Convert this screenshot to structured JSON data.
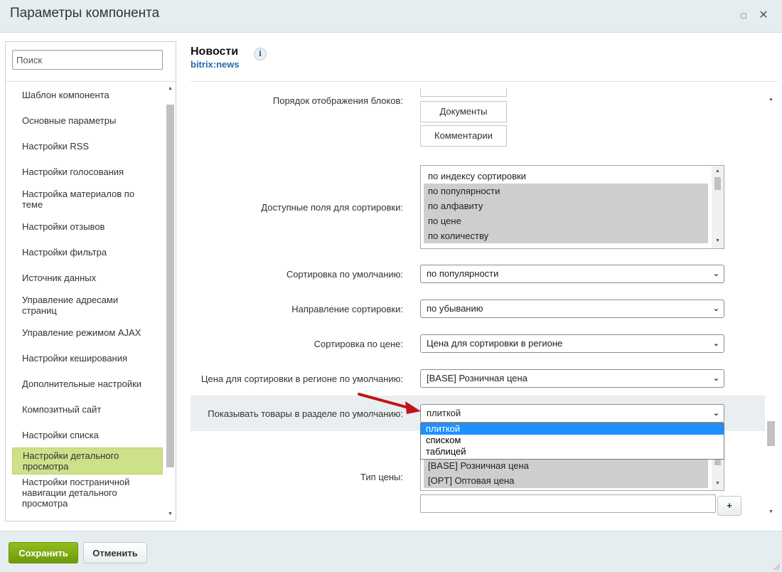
{
  "window": {
    "title": "Параметры компонента",
    "maximize_icon": "□",
    "close_icon": "✕"
  },
  "search": {
    "placeholder": "Поиск",
    "value": ""
  },
  "sidebar": {
    "items": [
      {
        "label": "Шаблон компонента"
      },
      {
        "label": "Основные параметры"
      },
      {
        "label": "Настройки RSS"
      },
      {
        "label": "Настройки голосования"
      },
      {
        "label": "Настройка материалов по теме"
      },
      {
        "label": "Настройки отзывов"
      },
      {
        "label": "Настройки фильтра"
      },
      {
        "label": "Источник данных"
      },
      {
        "label": "Управление адресами страниц"
      },
      {
        "label": "Управление режимом AJAX"
      },
      {
        "label": "Настройки кеширования"
      },
      {
        "label": "Дополнительные настройки"
      },
      {
        "label": "Композитный сайт"
      },
      {
        "label": "Настройки списка"
      },
      {
        "label": "Настройки детального просмотра",
        "active": true
      },
      {
        "label": "Настройки постраничной навигации детального просмотра"
      }
    ],
    "active_color": "#cce18a"
  },
  "component": {
    "title": "Новости",
    "info_icon": "i",
    "subtitle": "bitrix:news"
  },
  "form": {
    "block_order": {
      "label": "Порядок отображения блоков:",
      "buttons": [
        "Документы",
        "Комментарии"
      ]
    },
    "sort_fields": {
      "label": "Доступные поля для сортировки:",
      "options": [
        {
          "text": "по индексу сортировки",
          "selected": false
        },
        {
          "text": "по популярности",
          "selected": true
        },
        {
          "text": "по алфавиту",
          "selected": true
        },
        {
          "text": "по цене",
          "selected": true
        },
        {
          "text": "по количеству",
          "selected": true
        }
      ]
    },
    "default_sort": {
      "label": "Сортировка по умолчанию:",
      "value": "по популярности"
    },
    "sort_direction": {
      "label": "Направление сортировки:",
      "value": "по убыванию"
    },
    "price_sort": {
      "label": "Сортировка по цене:",
      "value": "Цена для сортировки в регионе"
    },
    "region_price": {
      "label": "Цена для сортировки в регионе по умолчанию:",
      "value": "[BASE] Розничная цена"
    },
    "view_mode": {
      "label": "Показывать товары в разделе по умолчанию:",
      "value": "плиткой",
      "options": [
        {
          "text": "плиткой",
          "selected": true
        },
        {
          "text": "списком",
          "selected": false
        },
        {
          "text": "таблицей",
          "selected": false
        }
      ]
    },
    "price_type": {
      "label": "Тип цены:",
      "options": [
        {
          "text": "[BASE] Розничная цена",
          "selected": true
        },
        {
          "text": "[OPT] Оптовая цена",
          "selected": true
        }
      ],
      "add_button": "+"
    }
  },
  "footer": {
    "save_label": "Сохранить",
    "cancel_label": "Отменить"
  },
  "colors": {
    "save_button": "#7aab12",
    "link": "#1e6bb1",
    "dropdown_highlight": "#1e90ff",
    "arrow": "#c0141a"
  }
}
